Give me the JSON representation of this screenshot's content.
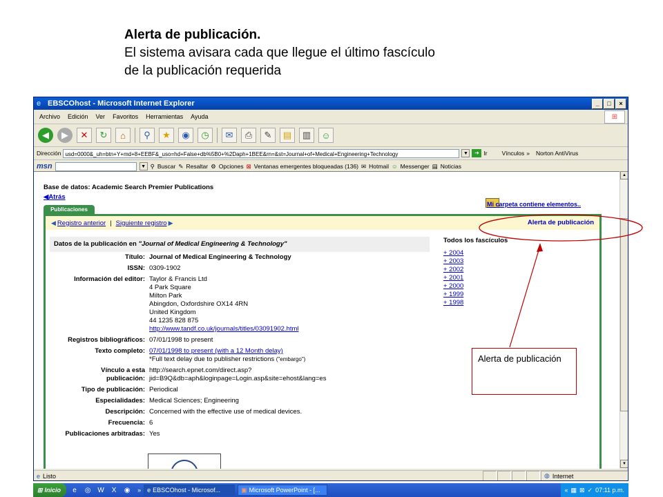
{
  "slide": {
    "title_bold": "Alerta de publicación.",
    "line1": "El sistema avisara cada que llegue el último fascículo",
    "line2": "de la publicación requerida"
  },
  "window": {
    "title": "EBSCOhost - Microsoft Internet Explorer",
    "minimize": "_",
    "maximize": "□",
    "close": "×"
  },
  "menu": [
    "Archivo",
    "Edición",
    "Ver",
    "Favoritos",
    "Herramientas",
    "Ayuda"
  ],
  "address": {
    "label": "Dirección",
    "value": "usd=0000&_uh=btn+Y+md+8+EEBF&_uso=hd+False+db%5B0+%2Daph+1BEE&rn=&st=Journal+of+Medical+Engineering+Technology",
    "go": "Ir",
    "links": "Vínculos",
    "chevron": "»",
    "antivirus": "Norton AntiVirus"
  },
  "msn": {
    "logo": "msn",
    "buscar": "Buscar",
    "resaltar": "Resaltar",
    "opciones": "Opciones",
    "popups": "Ventanas emergentes bloqueadas (136)",
    "hotmail": "Hotmail",
    "messenger": "Messenger",
    "noticias": "Noticias"
  },
  "page": {
    "database": "Base de datos: Academic Search Premier Publications",
    "back": "Atrás",
    "tab": "Publicaciones",
    "folder": "Mi carpeta contiene elementos..",
    "prev": "Registro anterior",
    "separator": "|",
    "next": "Siguiente registro",
    "alert": "Alerta de publicación",
    "detail_header_prefix": "Datos de la publicación en",
    "detail_header_journal": "\"Journal of Medical Engineering & Technology\"",
    "fields": {
      "titulo_label": "Título:",
      "titulo": "Journal of Medical Engineering & Technology",
      "issn_label": "ISSN:",
      "issn": "0309-1902",
      "editor_label": "Información del editor:",
      "editor_lines": [
        "Taylor & Francis Ltd",
        "4 Park Square",
        "Milton Park",
        "Abingdon, Oxfordshire OX14 4RN",
        "United Kingdom",
        "44 1235 828 875"
      ],
      "editor_url": "http://www.tandf.co.uk/journals/titles/03091902.html",
      "registros_label": "Registros bibliográficos:",
      "registros": "07/01/1998 to present",
      "texto_label": "Texto completo:",
      "texto_link": "07/01/1998 to present (with a 12 Month delay)",
      "texto_note": "*Full text delay due to publisher restrictions",
      "texto_note_small": "(\"embargo\")",
      "vinculo_label1": "Vínculo a esta",
      "vinculo_label2": "publicación:",
      "vinculo1": "http://search.epnet.com/direct.asp?",
      "vinculo2": "jid=B9Q&db=aph&loginpage=Login.asp&site=ehost&lang=es",
      "tipo_label": "Tipo de publicación:",
      "tipo": "Periodical",
      "esp_label": "Especialidades:",
      "esp": "Medical Sciences; Engineering",
      "desc_label": "Descripción:",
      "desc": "Concerned with the effective use of medical devices.",
      "freq_label": "Frecuencia:",
      "freq": "6",
      "arb_label": "Publicaciones arbitradas:",
      "arb": "Yes"
    },
    "issues_title": "Todos los fascículos",
    "issues": [
      "+ 2004",
      "+ 2003",
      "+ 2002",
      "+ 2001",
      "+ 2000",
      "+ 1999",
      "+ 1998"
    ]
  },
  "status": {
    "text": "Listo",
    "zone": "Internet"
  },
  "taskbar": {
    "start": "Inicio",
    "chevron": "»",
    "task1": "EBSCOhost - Microsof...",
    "task2": "Microsoft PowerPoint - [...",
    "tray_chevron": "«",
    "clock": "07:11 p.m."
  },
  "annotation": {
    "callout": "Alerta de publicación",
    "color": "#c00000"
  }
}
